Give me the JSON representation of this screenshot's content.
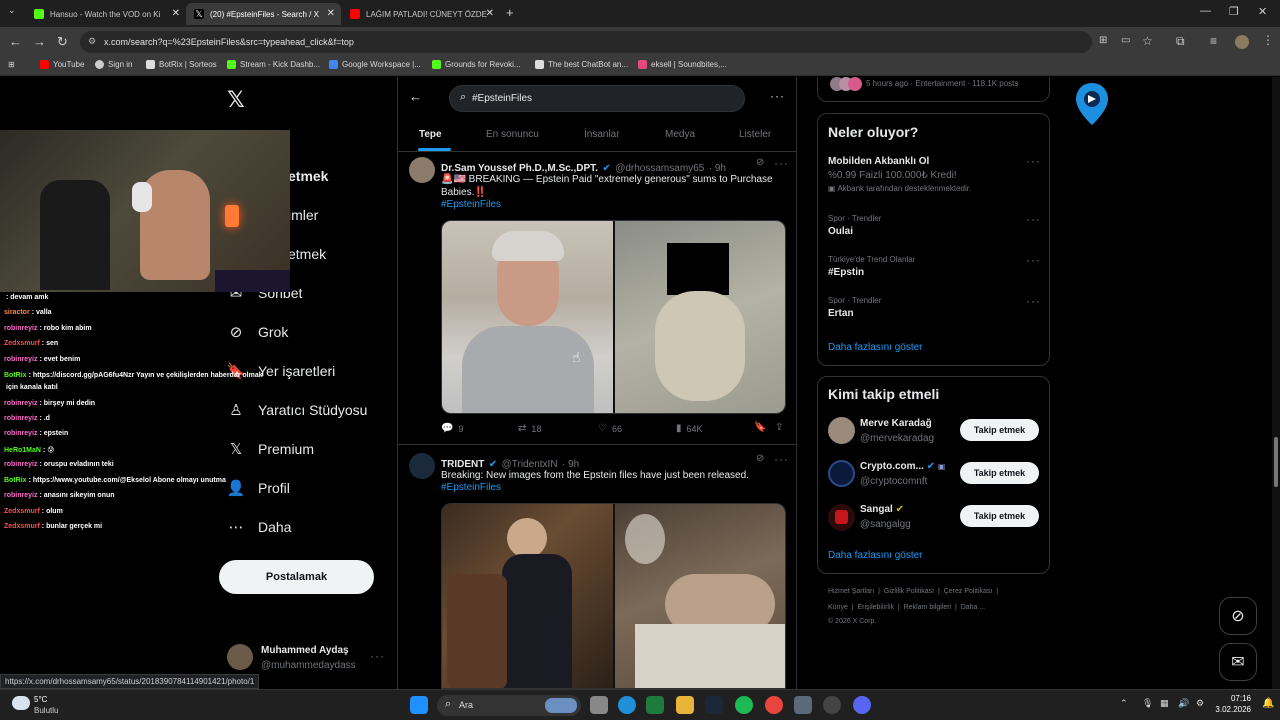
{
  "browser": {
    "tabs": [
      {
        "title": "Hansuo - Watch the VOD on Ki",
        "icon": "kick-icon",
        "color": "#53fc18"
      },
      {
        "title": "(20) #EpsteinFiles - Search / X",
        "icon": "x-icon",
        "color": "#ffffff"
      },
      {
        "title": "LAĞIM PATLADI! CÜNEYT ÖZDE",
        "icon": "youtube-icon",
        "color": "#ff0000"
      }
    ],
    "url": "x.com/search?q=%23EpsteinFiles&src=typeahead_click&f=top",
    "bookmarks": [
      {
        "label": "YouTube",
        "color": "#ff0000"
      },
      {
        "label": "Sign in",
        "color": "#cccccc"
      },
      {
        "label": "BotRix | Sorteos",
        "color": "#dddddd"
      },
      {
        "label": "Stream - Kick Dashb...",
        "color": "#53fc18"
      },
      {
        "label": "Google Workspace |...",
        "color": "#4285f4"
      },
      {
        "label": "Grounds for Revoki...",
        "color": "#53fc18"
      },
      {
        "label": "The best ChatBot an...",
        "color": "#dddddd"
      },
      {
        "label": "eksell | Soundbites,...",
        "color": "#e64980"
      }
    ]
  },
  "nav": {
    "items": [
      {
        "label": "etmek",
        "icon": "explore-icon"
      },
      {
        "label": "imler",
        "icon": "notifications-icon"
      },
      {
        "label": "etmek",
        "icon": "follow-icon"
      },
      {
        "label": "Sohbet",
        "icon": "chat-icon"
      },
      {
        "label": "Grok",
        "icon": "grok-icon"
      },
      {
        "label": "Yer işaretleri",
        "icon": "bookmark-icon"
      },
      {
        "label": "Yaratıcı Stüdyosu",
        "icon": "studio-icon"
      },
      {
        "label": "Premium",
        "icon": "x-icon"
      },
      {
        "label": "Profil",
        "icon": "profile-icon"
      },
      {
        "label": "Daha",
        "icon": "more-icon"
      }
    ],
    "post_button": "Postalamak",
    "account": {
      "name": "Muhammed Aydaş",
      "handle": "@muhammedaydass"
    }
  },
  "search": {
    "query": "#EpsteinFiles"
  },
  "feed_tabs": [
    "Tepe",
    "En sonuncu",
    "İnsanlar",
    "Medya",
    "Listeler"
  ],
  "tweets": [
    {
      "name": "Dr.Sam Youssef Ph.D.,M.Sc.,DPT.",
      "handle": "@drhossamsamy65",
      "time": "· 9h",
      "text": "🚨🇺🇸 BREAKING — Epstein Paid \"extremely generous\" sums to Purchase Babies.‼️",
      "hashtag": "#EpsteinFiles",
      "replies": "9",
      "reposts": "18",
      "likes": "66",
      "views": "64K"
    },
    {
      "name": "TRIDENT",
      "handle": "@TridentxIN",
      "time": "· 9h",
      "text": "Breaking: New images from the Epstein files have just been released.",
      "hashtag": "#EpsteinFiles"
    }
  ],
  "top_meta": "5 hours ago · Entertainment · 118.1K posts",
  "trends": {
    "title": "Neler oluyor?",
    "ad": {
      "title": "Mobilden Akbanklı Ol",
      "line": "%0.99 Faizli 100.000₺ Kredi!",
      "sponsor": "Akbank tarafından desteklenmektedir."
    },
    "items": [
      {
        "context": "Spor · Trendler",
        "name": "Oulai"
      },
      {
        "context": "Türkiye'de Trend Olanlar",
        "name": "#Epstin"
      },
      {
        "context": "Spor · Trendler",
        "name": "Ertan"
      }
    ],
    "show_more": "Daha fazlasını göster"
  },
  "who_to_follow": {
    "title": "Kimi takip etmeli",
    "follow_label": "Takip etmek",
    "accounts": [
      {
        "name": "Merve Karadağ",
        "handle": "@mervekaradag"
      },
      {
        "name": "Crypto.com...",
        "handle": "@cryptocomnft"
      },
      {
        "name": "Sangal",
        "handle": "@sangalgg"
      }
    ],
    "show_more": "Daha fazlasını göster"
  },
  "footer": {
    "line1": [
      "Hizmet Şartları",
      "Gizlilik Politikası",
      "Çerez Politikası"
    ],
    "line2": [
      "Künye",
      "Erişilebilirlik",
      "Reklam bilgileri",
      "Daha ..."
    ],
    "copyright": "© 2026 X Corp."
  },
  "chat": [
    {
      "user": "",
      "msg": ": devam amk",
      "color": "#ff4d4d"
    },
    {
      "user": "siractor",
      "msg": ": valla",
      "color": "#ff8a3d"
    },
    {
      "user": "robinreyiz",
      "msg": ": robo kim abim",
      "color": "#ff6bcb"
    },
    {
      "user": "Zedxsmurf",
      "msg": ": sen",
      "color": "#ff4d4d"
    },
    {
      "user": "robinreyiz",
      "msg": ": evet benim",
      "color": "#ff6bcb"
    },
    {
      "user": "BotRix",
      "msg": ": https://discord.gg/pAG6fu4Nzr Yayın ve çekilişlerden haberdar olmak",
      "color": "#53fc18"
    },
    {
      "user": "",
      "msg": "için kanala katıl",
      "color": "#ffffff"
    },
    {
      "user": "robinreyiz",
      "msg": ": birşey mi dedin",
      "color": "#ff6bcb"
    },
    {
      "user": "robinreyiz",
      "msg": ": .d",
      "color": "#ff6bcb"
    },
    {
      "user": "robinreyiz",
      "msg": ": epstein",
      "color": "#ff6bcb"
    },
    {
      "user": "HeRo1MaN",
      "msg": ": 😰",
      "color": "#53fc18"
    },
    {
      "user": "robinreyiz",
      "msg": ": oruspu evladının teki",
      "color": "#ff6bcb"
    },
    {
      "user": "BotRix",
      "msg": ": https://www.youtube.com/@Ekselol Abone olmayı unutma",
      "color": "#53fc18"
    },
    {
      "user": "robinreyiz",
      "msg": ": anasını sikeyim onun",
      "color": "#ff6bcb"
    },
    {
      "user": "Zedxsmurf",
      "msg": ": olum",
      "color": "#ff4d4d"
    },
    {
      "user": "Zedxsmurf",
      "msg": ": bunlar gerçek mi",
      "color": "#ff4d4d"
    }
  ],
  "status_url": "https://x.com/drhossamsamy65/status/2018390784114901421/photo/1",
  "taskbar": {
    "weather_temp": "5°C",
    "weather_desc": "Bulutlu",
    "search_label": "Ara",
    "time": "07:16",
    "date": "3.02.2026"
  }
}
